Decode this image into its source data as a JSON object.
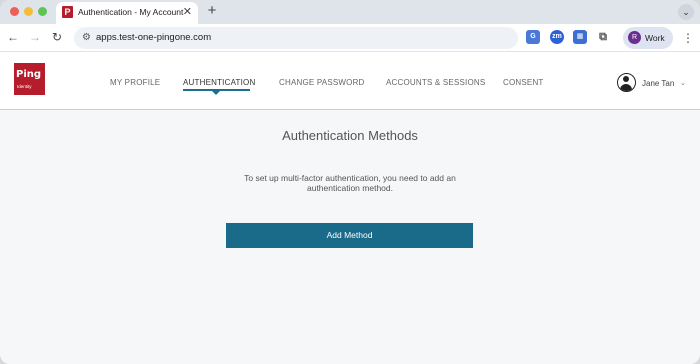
{
  "browser": {
    "tab_favicon": "P",
    "tab_title": "Authentication - My Account",
    "url": "apps.test-one-pingone.com",
    "profile_initial": "R",
    "profile_label": "Work"
  },
  "app": {
    "logo_text": "Ping",
    "logo_subtext": "Identity",
    "nav": [
      {
        "label": "MY PROFILE",
        "active": false
      },
      {
        "label": "AUTHENTICATION",
        "active": true
      },
      {
        "label": "CHANGE PASSWORD",
        "active": false
      },
      {
        "label": "ACCOUNTS & SESSIONS",
        "active": false
      },
      {
        "label": "CONSENT",
        "active": false
      }
    ],
    "user_name": "Jane Tan"
  },
  "main": {
    "title": "Authentication Methods",
    "description": "To set up multi-factor authentication, you need to add an authentication method.",
    "add_button": "Add Method"
  },
  "colors": {
    "brand_red": "#b61d2c",
    "accent_teal": "#1a6a8a"
  }
}
